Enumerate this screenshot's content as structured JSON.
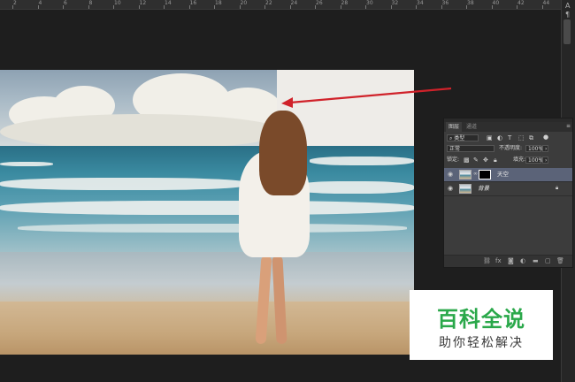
{
  "ruler": {
    "ticks": [
      "2",
      "4",
      "6",
      "8",
      "10",
      "12",
      "14",
      "16",
      "18",
      "20",
      "22",
      "24",
      "26",
      "28",
      "30",
      "32",
      "34",
      "36",
      "38",
      "40",
      "42",
      "44"
    ]
  },
  "right_strip": {
    "glyph_a": "A",
    "glyph_b": "¶"
  },
  "layers_panel": {
    "tabs": [
      "图层",
      "通道"
    ],
    "filter_kind": "类型",
    "blend_mode": "正常",
    "opacity_label": "不透明度:",
    "opacity_value": "100%",
    "lock_label": "锁定:",
    "fill_label": "填充:",
    "fill_value": "100%",
    "layers": [
      {
        "name": "天空",
        "selected": true,
        "has_mask": true,
        "visible": true
      },
      {
        "name": "背景",
        "selected": false,
        "locked": true,
        "visible": true
      }
    ]
  },
  "watermark": {
    "title": "百科全说",
    "subtitle": "助你轻松解决"
  },
  "colors": {
    "arrow": "#d0222a",
    "watermark_green": "#2aa84a",
    "selected_layer": "#5b6378"
  }
}
